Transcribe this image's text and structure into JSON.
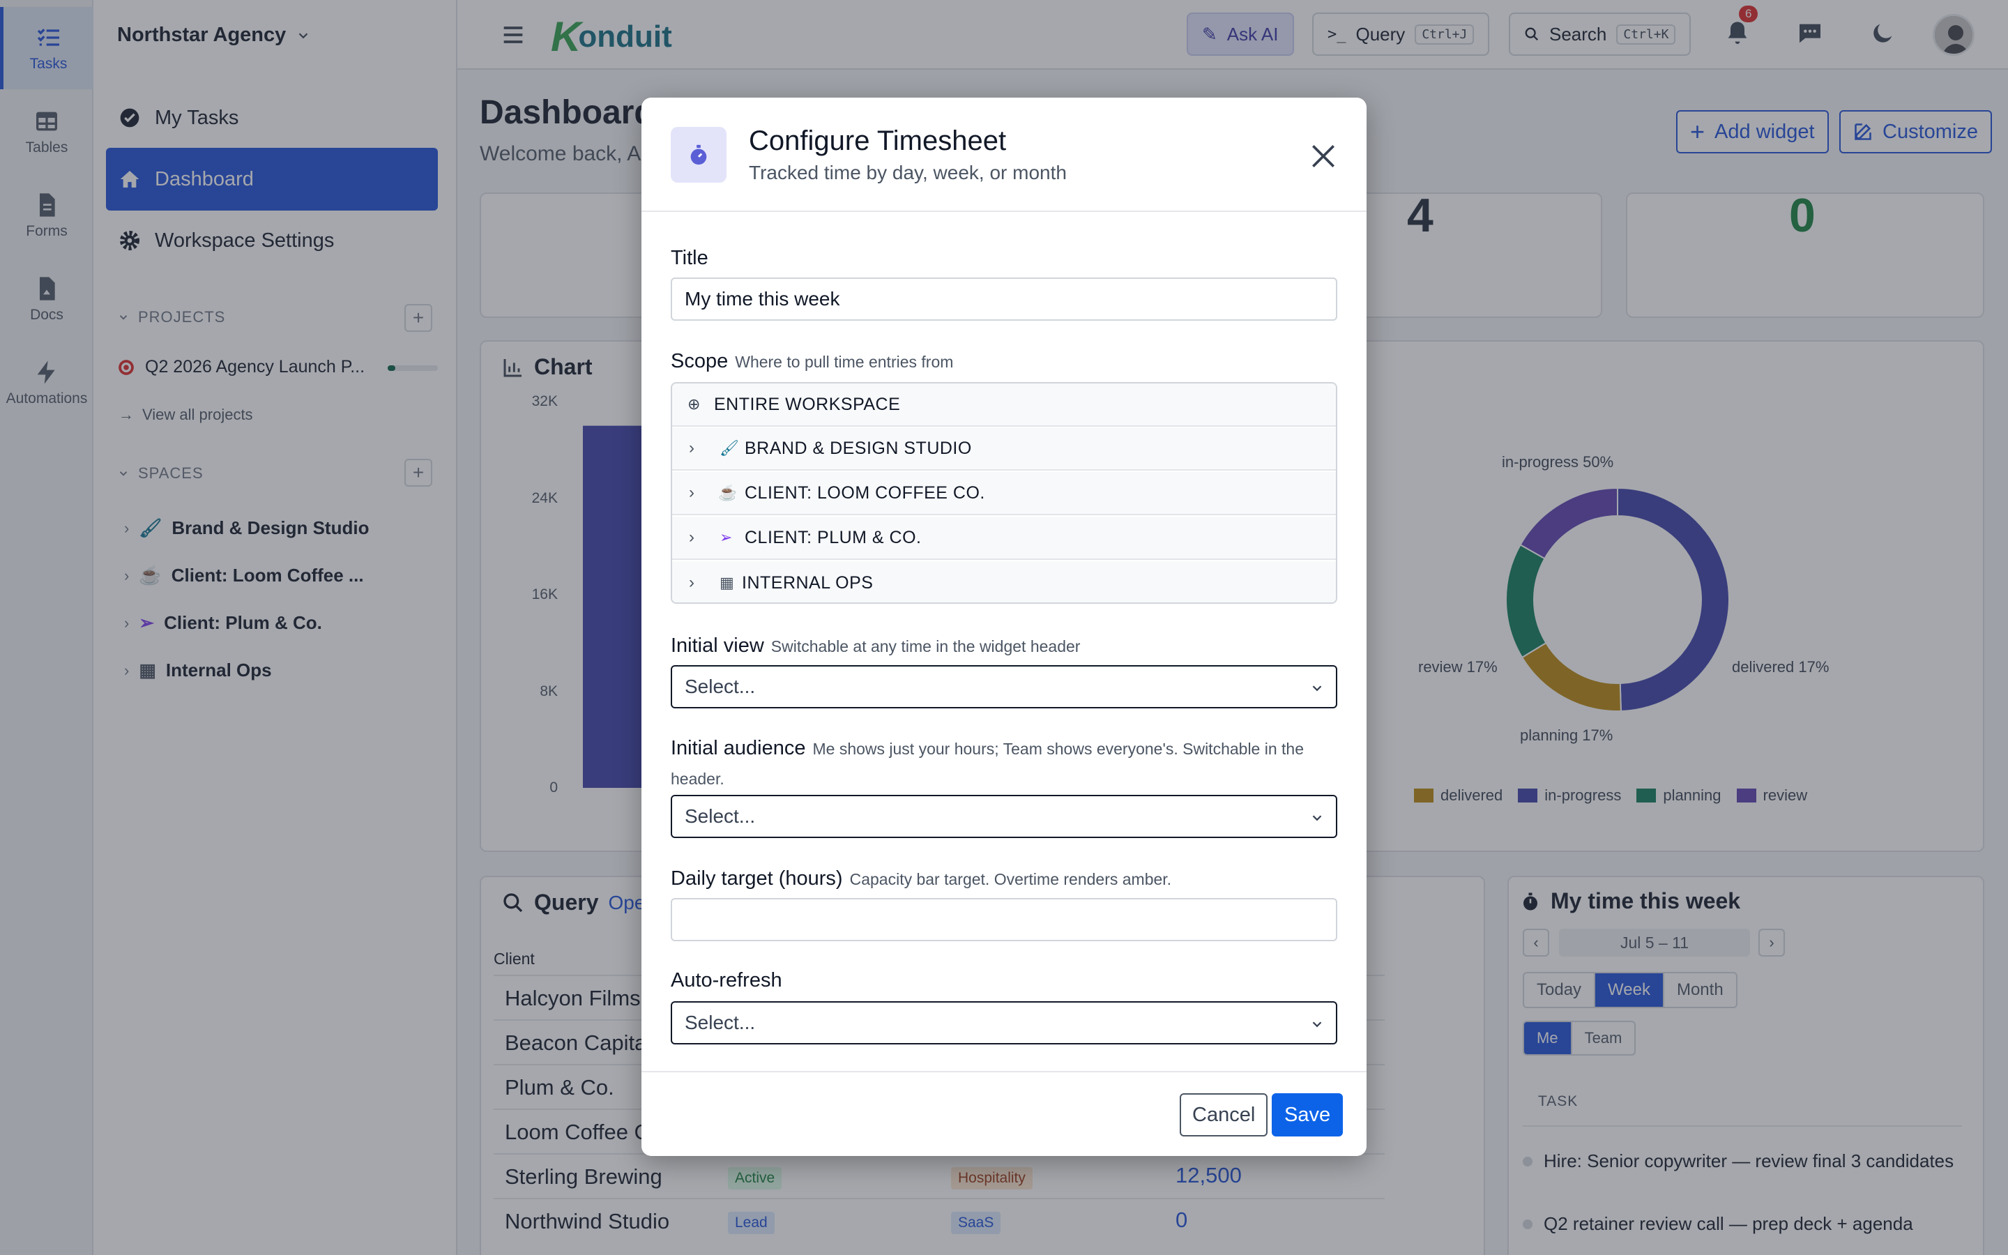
{
  "rail": {
    "items": [
      {
        "label": "Tasks"
      },
      {
        "label": "Tables"
      },
      {
        "label": "Forms"
      },
      {
        "label": "Docs"
      },
      {
        "label": "Automations"
      }
    ]
  },
  "sidebar": {
    "workspace": "Northstar Agency",
    "nav": [
      {
        "label": "My Tasks"
      },
      {
        "label": "Dashboard"
      },
      {
        "label": "Workspace Settings"
      }
    ],
    "projects_heading": "PROJECTS",
    "project": {
      "name": "Q2 2026 Agency Launch P...",
      "progress": 0.15
    },
    "view_all": "View all projects",
    "spaces_heading": "SPACES",
    "spaces": [
      {
        "label": "Brand & Design Studio"
      },
      {
        "label": "Client: Loom Coffee ..."
      },
      {
        "label": "Client: Plum & Co."
      },
      {
        "label": "Internal Ops"
      }
    ]
  },
  "topbar": {
    "logo": "onduit",
    "logo_k": "K",
    "ask_ai": "Ask AI",
    "query": "Query",
    "query_kbd": "Ctrl+J",
    "search": "Search",
    "search_kbd": "Ctrl+K",
    "notifications": "6"
  },
  "dashboard": {
    "title": "Dashboard",
    "subtitle": "Welcome back, A",
    "add_widget": "Add widget",
    "customize": "Customize",
    "stat_a": "4",
    "stat_b": "0",
    "chart_title": "Chart",
    "query_title": "Query",
    "query_link": "Ope",
    "query_header": "Client",
    "query_rows": [
      {
        "client": "Halcyon Films"
      },
      {
        "client": "Beacon Capita"
      },
      {
        "client": "Plum & Co."
      },
      {
        "client": "Loom Coffee C"
      },
      {
        "client": "Sterling Brewing",
        "status": "Active",
        "industry": "Hospitality",
        "value": "12,500"
      },
      {
        "client": "Northwind Studio",
        "status": "Lead",
        "industry": "SaaS",
        "value": "0"
      }
    ],
    "timesheet_title": "My time this week",
    "timesheet_range": "Jul 5 – 11",
    "timesheet_views": [
      "Today",
      "Week",
      "Month"
    ],
    "timesheet_audience": [
      "Me",
      "Team"
    ],
    "task_header": "TASK",
    "tasks": [
      "Hire: Senior copywriter — review final 3 candidates",
      "Q2 retainer review call — prep deck + agenda"
    ]
  },
  "chart_data": [
    {
      "type": "bar",
      "title": "Chart",
      "y_ticks": [
        "32K",
        "24K",
        "16K",
        "8K",
        "0"
      ],
      "ylim": [
        0,
        32000
      ],
      "values": [
        30000
      ]
    },
    {
      "type": "pie",
      "categories": [
        "delivered",
        "in-progress",
        "planning",
        "review"
      ],
      "values": [
        17,
        50,
        17,
        17
      ],
      "labels": [
        "delivered 17%",
        "in-progress 50%",
        "planning 17%",
        "review 17%"
      ],
      "colors": [
        "#b8860b",
        "#3b3ea8",
        "#0b7a5a",
        "#5b3fb0"
      ],
      "legend_position": "bottom"
    }
  ],
  "modal": {
    "title": "Configure Timesheet",
    "subtitle": "Tracked time by day, week, or month",
    "title_label": "Title",
    "title_value": "My time this week",
    "scope_label": "Scope",
    "scope_hint": "Where to pull time entries from",
    "scope_items": [
      {
        "label": "ENTIRE WORKSPACE",
        "icon": "globe-icon"
      },
      {
        "label": "BRAND & DESIGN STUDIO",
        "icon": "brush-icon"
      },
      {
        "label": "CLIENT: LOOM COFFEE CO.",
        "icon": "coffee-icon"
      },
      {
        "label": "CLIENT: PLUM & CO.",
        "icon": "send-icon"
      },
      {
        "label": "INTERNAL OPS",
        "icon": "building-icon"
      }
    ],
    "view_label": "Initial view",
    "view_hint": "Switchable at any time in the widget header",
    "view_placeholder": "Select...",
    "audience_label": "Initial audience",
    "audience_hint": "Me shows just your hours; Team shows everyone's. Switchable in the header.",
    "audience_placeholder": "Select...",
    "target_label": "Daily target (hours)",
    "target_hint": "Capacity bar target. Overtime renders amber.",
    "target_value": "",
    "refresh_label": "Auto-refresh",
    "refresh_placeholder": "Select...",
    "cancel": "Cancel",
    "save": "Save"
  }
}
